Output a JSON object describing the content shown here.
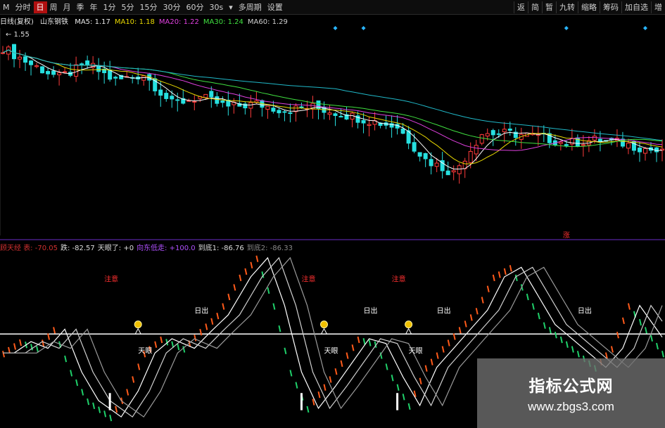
{
  "toolbar": {
    "items": [
      "M",
      "分时",
      "日",
      "周",
      "月",
      "季",
      "年",
      "1分",
      "5分",
      "15分",
      "30分",
      "60分",
      "30s",
      "▾",
      "多周期",
      "设置"
    ],
    "active_index": 2,
    "right_items": [
      "返",
      "简",
      "暂",
      "九转",
      "缩略",
      "筹码",
      "加自选",
      "增"
    ]
  },
  "main_legend": {
    "prefix": "日线(复权)",
    "stock": "山东钢铁",
    "items": [
      {
        "text": "MA5: 1.17",
        "color": "#e8e8e8"
      },
      {
        "text": "MA10: 1.18",
        "color": "#e8d800"
      },
      {
        "text": "MA20: 1.22",
        "color": "#e040e0"
      },
      {
        "text": "MA30: 1.24",
        "color": "#40e040"
      },
      {
        "text": "MA60: 1.29",
        "color": "#cfcfcf"
      }
    ]
  },
  "indicator_legend": [
    {
      "text": "顾天经 表: -70.05",
      "color": "#d03030"
    },
    {
      "text": "跌: -82.57",
      "color": "#dddddd"
    },
    {
      "text": "天眼了: +0",
      "color": "#dddddd"
    },
    {
      "text": "向东低走: +100.0",
      "color": "#b050ff"
    },
    {
      "text": "到底1: -86.76",
      "color": "#dddddd"
    },
    {
      "text": "到底2: -86.33",
      "color": "#888888"
    }
  ],
  "colors": {
    "up": "#ff3b3b",
    "down": "#27e0e0",
    "ma5": "#ffffff",
    "ma10": "#e8d800",
    "ma20": "#e040e0",
    "ma30": "#40e040",
    "ma60": "#20b8c8"
  },
  "watermark": {
    "title": "指标公式网",
    "url": "www.zbgs3.com"
  },
  "chart_data": [
    {
      "type": "candlestick",
      "title": "",
      "price_mark": "1.55",
      "ylim": [
        0.95,
        1.58
      ],
      "day_count": 118,
      "note_label": "涨",
      "note_day": 100,
      "signal_days": [
        59,
        64,
        100,
        114
      ],
      "x": [
        0,
        5,
        10,
        15,
        20,
        25,
        30,
        35,
        40,
        45,
        50,
        55,
        60,
        65,
        70,
        75,
        80,
        85,
        90,
        95,
        100,
        105,
        110,
        115,
        117
      ],
      "close": [
        1.52,
        1.47,
        1.43,
        1.47,
        1.42,
        1.44,
        1.35,
        1.37,
        1.34,
        1.35,
        1.33,
        1.34,
        1.32,
        1.3,
        1.28,
        1.18,
        1.14,
        1.26,
        1.26,
        1.25,
        1.23,
        1.24,
        1.23,
        1.21,
        1.2
      ]
    },
    {
      "type": "line",
      "title": "",
      "ylim": [
        -95,
        85
      ],
      "x": [
        0,
        3,
        6,
        9,
        12,
        15,
        19,
        22,
        25,
        28,
        32,
        35,
        38,
        42,
        45,
        48,
        51,
        54,
        57,
        60,
        63,
        66,
        69,
        72,
        75,
        78,
        81,
        84,
        87,
        90,
        93,
        96,
        99,
        102,
        105,
        108,
        111,
        114,
        117
      ],
      "values": [
        -20,
        -8,
        -15,
        5,
        -40,
        -70,
        -87,
        -60,
        -20,
        -5,
        -15,
        3,
        20,
        60,
        80,
        30,
        -40,
        -78,
        -55,
        -30,
        -5,
        -10,
        -45,
        -75,
        -35,
        -15,
        5,
        25,
        60,
        70,
        40,
        10,
        -5,
        -20,
        -35,
        -15,
        30,
        5,
        -20
      ],
      "labels": [
        {
          "text": "注意",
          "x": 19,
          "y": 55,
          "color": "#ff3030"
        },
        {
          "text": "注意",
          "x": 54,
          "y": 55,
          "color": "#ff3030"
        },
        {
          "text": "注意",
          "x": 70,
          "y": 55,
          "color": "#ff3030"
        },
        {
          "text": "日出",
          "x": 35,
          "y": 22,
          "color": "#ffffff"
        },
        {
          "text": "日出",
          "x": 65,
          "y": 22,
          "color": "#ffffff"
        },
        {
          "text": "日出",
          "x": 78,
          "y": 22,
          "color": "#ffffff"
        },
        {
          "text": "日出",
          "x": 103,
          "y": 22,
          "color": "#ffffff"
        },
        {
          "text": "天眼",
          "x": 25,
          "y": -20,
          "color": "#ffffff"
        },
        {
          "text": "天眼",
          "x": 58,
          "y": -20,
          "color": "#ffffff"
        },
        {
          "text": "天眼",
          "x": 73,
          "y": -20,
          "color": "#ffffff"
        }
      ],
      "sun_markers": [
        24,
        57,
        72
      ],
      "white_bars": [
        19,
        53,
        70
      ]
    }
  ]
}
